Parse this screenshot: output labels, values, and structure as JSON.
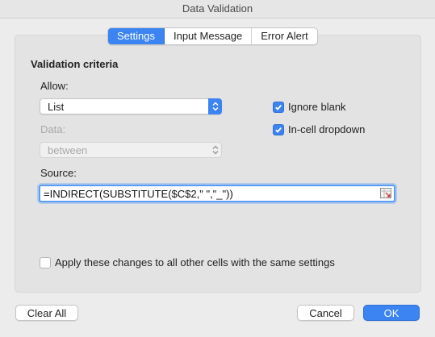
{
  "window": {
    "title": "Data Validation"
  },
  "tabs": [
    {
      "label": "Settings",
      "active": true
    },
    {
      "label": "Input Message",
      "active": false
    },
    {
      "label": "Error Alert",
      "active": false
    }
  ],
  "criteria": {
    "heading": "Validation criteria",
    "allow_label": "Allow:",
    "allow_value": "List",
    "data_label": "Data:",
    "data_value": "between",
    "source_label": "Source:",
    "source_value": "=INDIRECT(SUBSTITUTE($C$2,\" \",\"_\"))"
  },
  "options": {
    "ignore_blank": {
      "label": "Ignore blank",
      "checked": true
    },
    "in_cell_dropdown": {
      "label": "In-cell dropdown",
      "checked": true
    },
    "apply_all": {
      "label": "Apply these changes to all other cells with the same settings",
      "checked": false
    }
  },
  "buttons": {
    "clear_all": "Clear All",
    "cancel": "Cancel",
    "ok": "OK"
  },
  "colors": {
    "accent": "#3b84f1",
    "window_bg": "#ececec",
    "panel_bg": "#e3e3e3"
  }
}
